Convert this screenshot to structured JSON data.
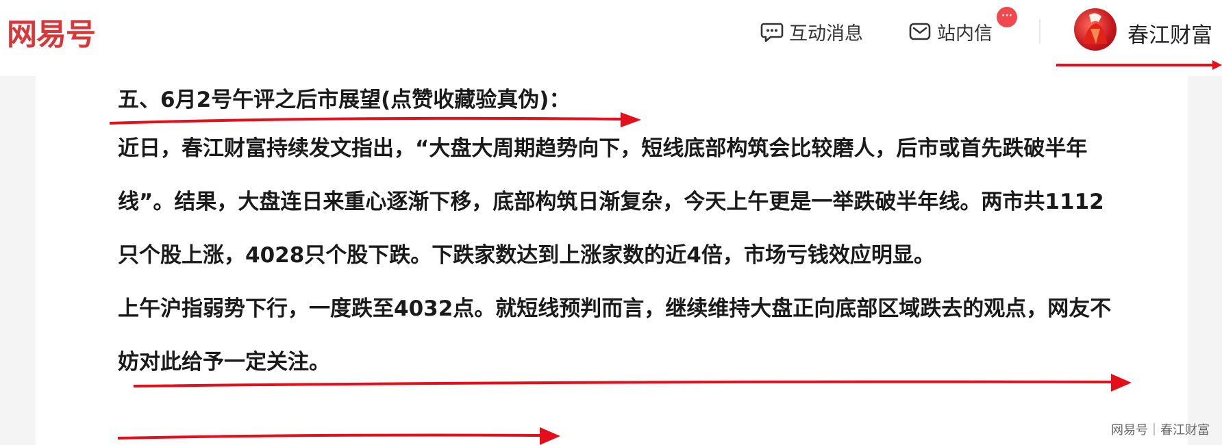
{
  "header": {
    "logo": "网易号",
    "nav": {
      "messages_label": "互动消息",
      "inbox_label": "站内信",
      "inbox_badge": "···"
    },
    "user": {
      "name": "春江财富"
    }
  },
  "article": {
    "heading": "五、6月2号午评之后市展望(点赞收藏验真伪)：",
    "paragraph1": "近日，春江财富持续发文指出，“大盘大周期趋势向下，短线底部构筑会比较磨人，后市或首先跌破半年线”。结果，大盘连日来重心逐渐下移，底部构筑日渐复杂，今天上午更是一举跌破半年线。两市共1112只个股上涨，4028只个股下跌。下跌家数达到上涨家数的近4倍，市场亏钱效应明显。",
    "paragraph2": "上午沪指弱势下行，一度跌至4032点。就短线预判而言，继续维持大盘正向底部区域跌去的观点，网友不妨对此给予一定关注。"
  },
  "watermark": "网易号｜春江财富",
  "colors": {
    "brand": "#d8373a",
    "annotation": "#e3101c",
    "badge": "#f0484d"
  }
}
